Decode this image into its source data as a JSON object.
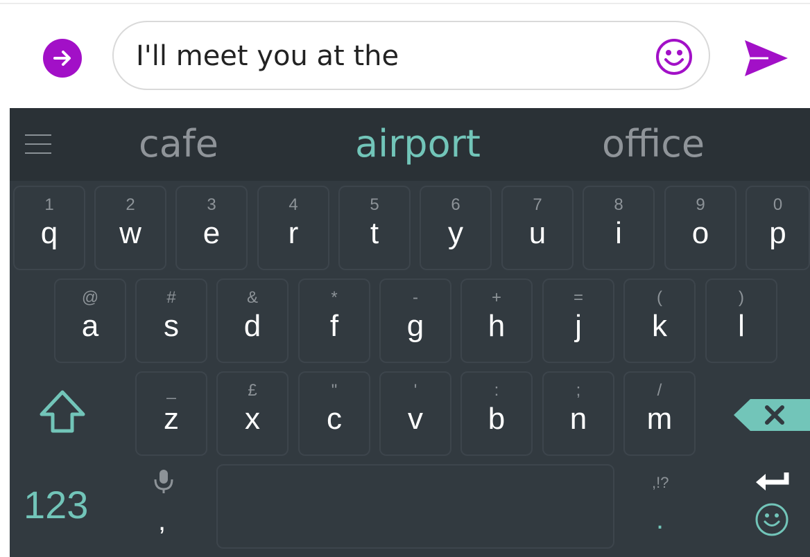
{
  "compose": {
    "message_text": "I'll meet you at the"
  },
  "suggestions": {
    "items": [
      "cafe",
      "airport",
      "office"
    ]
  },
  "keyboard": {
    "row1": [
      {
        "hint": "1",
        "ch": "q"
      },
      {
        "hint": "2",
        "ch": "w"
      },
      {
        "hint": "3",
        "ch": "e"
      },
      {
        "hint": "4",
        "ch": "r"
      },
      {
        "hint": "5",
        "ch": "t"
      },
      {
        "hint": "6",
        "ch": "y"
      },
      {
        "hint": "7",
        "ch": "u"
      },
      {
        "hint": "8",
        "ch": "i"
      },
      {
        "hint": "9",
        "ch": "o"
      },
      {
        "hint": "0",
        "ch": "p"
      }
    ],
    "row2": [
      {
        "hint": "@",
        "ch": "a"
      },
      {
        "hint": "#",
        "ch": "s"
      },
      {
        "hint": "&",
        "ch": "d"
      },
      {
        "hint": "*",
        "ch": "f"
      },
      {
        "hint": "-",
        "ch": "g"
      },
      {
        "hint": "+",
        "ch": "h"
      },
      {
        "hint": "=",
        "ch": "j"
      },
      {
        "hint": "(",
        "ch": "k"
      },
      {
        "hint": ")",
        "ch": "l"
      }
    ],
    "row3": [
      {
        "hint": "_",
        "ch": "z"
      },
      {
        "hint": "£",
        "ch": "x"
      },
      {
        "hint": "\"",
        "ch": "c"
      },
      {
        "hint": "'",
        "ch": "v"
      },
      {
        "hint": ":",
        "ch": "b"
      },
      {
        "hint": ";",
        "ch": "n"
      },
      {
        "hint": "/",
        "ch": "m"
      }
    ],
    "numbers_label": "123",
    "comma_label": ",",
    "punct_hint": ",!?",
    "period_label": "."
  },
  "colors": {
    "accent_purple": "#a210c7",
    "accent_teal": "#72c5b9",
    "keyboard_bg": "#323a40",
    "suggest_bg": "#2a3136"
  },
  "icons": {
    "attach": "arrow-right-circle-icon",
    "emoji": "smiley-icon",
    "send": "send-icon",
    "menu": "menu-icon",
    "shift": "shift-icon",
    "backspace": "backspace-icon",
    "mic": "mic-icon",
    "enter": "enter-icon"
  }
}
